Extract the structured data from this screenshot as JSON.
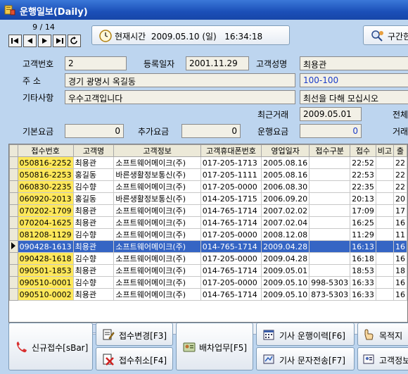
{
  "window": {
    "title": "운행일보(Daily)"
  },
  "nav": {
    "page": "9 / 14"
  },
  "toolbar": {
    "time_label": "현재시간",
    "date": "2009.05.10 (일)",
    "time": "16:34:18",
    "region_label": "구간한"
  },
  "form": {
    "customer_no_label": "고객번호",
    "customer_no": "2",
    "reg_date_label": "등록일자",
    "reg_date": "2001.11.29",
    "customer_name_label": "고객성명",
    "customer_name": "최용관",
    "address_label": "주   소",
    "address": "경기 광명시 옥길동",
    "address_no": "100-100",
    "other_label": "기타사항",
    "other": "우수고객입니다",
    "memo": "최선을 다해 모십시오",
    "recent_label": "최근거래",
    "recent": "2009.05.01",
    "total_label": "전체",
    "base_fee_label": "기본요금",
    "base_fee": "0",
    "extra_fee_label": "추가요금",
    "extra_fee": "0",
    "fare_label": "운행요금",
    "fare": "0",
    "trade_label": "거래"
  },
  "grid": {
    "columns": [
      "접수번호",
      "고객명",
      "고객정보",
      "고객휴대폰번호",
      "영업일자",
      "접수구분",
      "접수",
      "비고",
      "출"
    ],
    "rows": [
      [
        "050816-2252",
        "최용관",
        "소프트웨어메이크(주)",
        "017-205-1713",
        "2005.08.16",
        "",
        "22:52",
        "",
        "22"
      ],
      [
        "050816-2253",
        "홍길동",
        "바른생활정보통신(주)",
        "017-205-1111",
        "2005.08.16",
        "",
        "22:53",
        "",
        "22"
      ],
      [
        "060830-2235",
        "김수향",
        "소프트웨어메이크(주)",
        "017-205-0000",
        "2006.08.30",
        "",
        "22:35",
        "",
        "22"
      ],
      [
        "060920-2013",
        "홍길동",
        "바른생활정보통신(주)",
        "014-205-1715",
        "2006.09.20",
        "",
        "20:13",
        "",
        "20"
      ],
      [
        "070202-1709",
        "최용관",
        "소프트웨어메이크(주)",
        "014-765-1714",
        "2007.02.02",
        "",
        "17:09",
        "",
        "17"
      ],
      [
        "070204-1625",
        "최용관",
        "소프트웨어메이크(주)",
        "014-765-1714",
        "2007.02.04",
        "",
        "16:25",
        "",
        "16"
      ],
      [
        "081208-1129",
        "김수향",
        "소프트웨어메이크(주)",
        "017-205-0000",
        "2008.12.08",
        "",
        "11:29",
        "",
        "11"
      ],
      [
        "090428-1613",
        "최용관",
        "소프트웨어메이크(주)",
        "014-765-1714",
        "2009.04.28",
        "",
        "16:13",
        "",
        "16"
      ],
      [
        "090428-1618",
        "김수향",
        "소프트웨어메이크(주)",
        "017-205-0000",
        "2009.04.28",
        "",
        "16:18",
        "",
        "16"
      ],
      [
        "090501-1853",
        "최용관",
        "소프트웨어메이크(주)",
        "014-765-1714",
        "2009.05.01",
        "",
        "18:53",
        "",
        "18"
      ],
      [
        "090510-0001",
        "김수향",
        "소프트웨어메이크(주)",
        "017-205-0000",
        "2009.05.10",
        "998-5303",
        "16:33",
        "",
        "16"
      ],
      [
        "090510-0002",
        "최용관",
        "소프트웨어메이크(주)",
        "014-765-1714",
        "2009.05.10",
        "873-5303",
        "16:33",
        "",
        "16"
      ]
    ]
  },
  "buttons": {
    "new_receipt": "신규접수[sBar]",
    "change_receipt": "접수변경[F3]",
    "cancel_receipt": "접수취소[F4]",
    "dispatch": "배차업무[F5]",
    "driver_history": "기사 운행이력[F6]",
    "driver_sms": "기사 문자전송[F7]",
    "destination": "목적지",
    "customer_info": "고객정보"
  }
}
